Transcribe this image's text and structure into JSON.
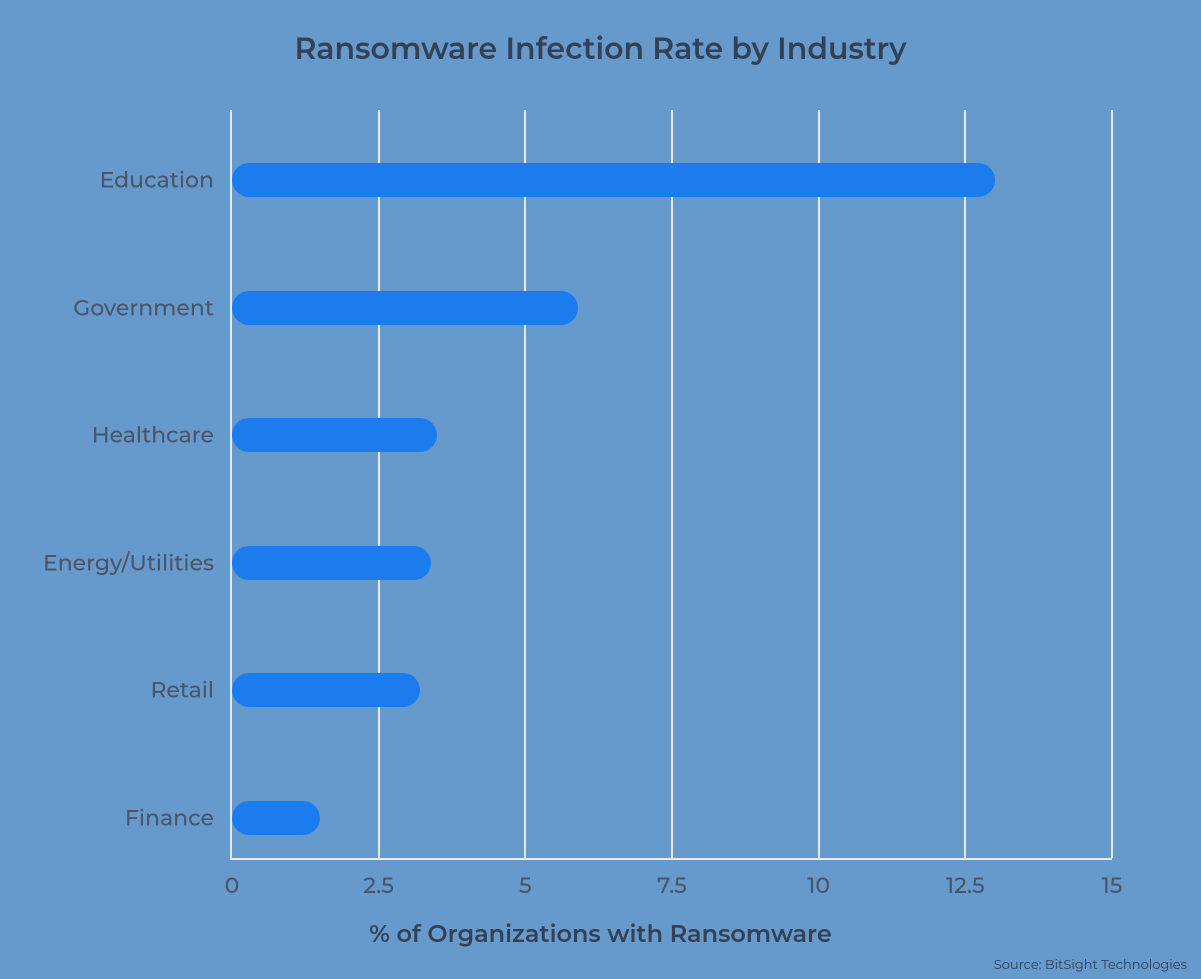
{
  "chart_data": {
    "type": "bar",
    "orientation": "horizontal",
    "title": "Ransomware Infection Rate by Industry",
    "xlabel": "% of Organizations with Ransomware",
    "ylabel": "",
    "categories": [
      "Education",
      "Government",
      "Healthcare",
      "Energy/Utilities",
      "Retail",
      "Finance"
    ],
    "values": [
      13.0,
      5.9,
      3.5,
      3.4,
      3.2,
      1.5
    ],
    "xlim": [
      0,
      15
    ],
    "xticks": [
      0,
      2.5,
      5,
      7.5,
      10,
      12.5,
      15
    ],
    "xtick_labels": [
      "0",
      "2.5",
      "5",
      "7.5",
      "10",
      "12.5",
      "15"
    ],
    "bar_color": "#1b7ced",
    "grid": true,
    "source": "Source: BitSight Technologies"
  }
}
